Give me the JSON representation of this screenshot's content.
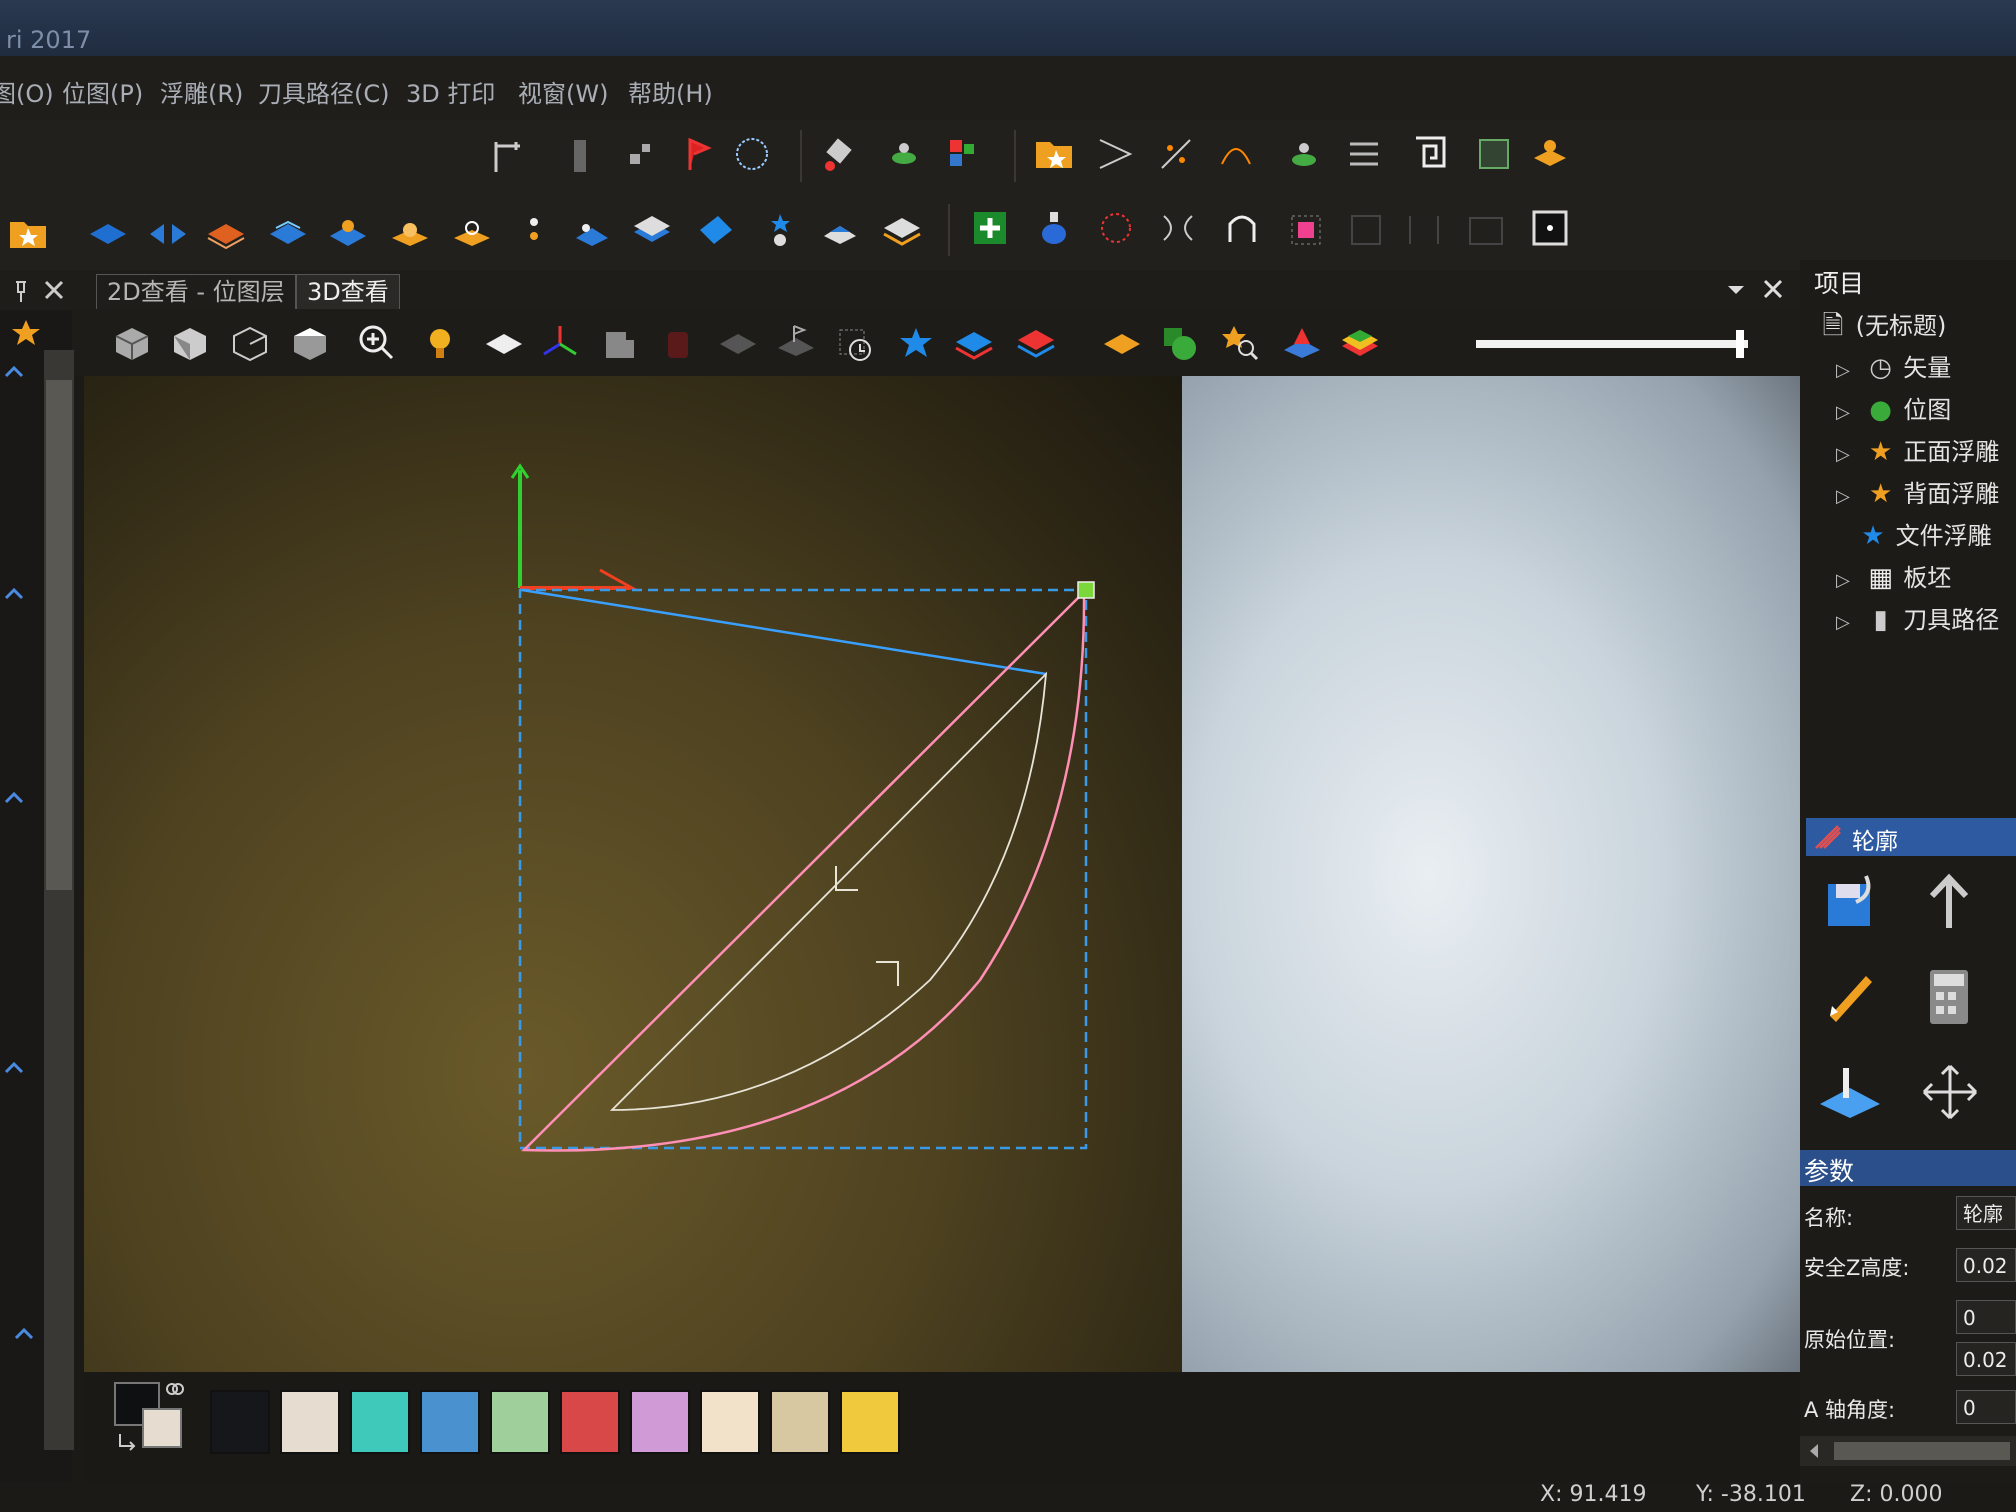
{
  "app": {
    "title_fragment": "ri 2017"
  },
  "menu": {
    "items": [
      "图(O)",
      "位图(P)",
      "浮雕(R)",
      "刀具路径(C)",
      "3D 打印",
      "视窗(W)",
      "帮助(H)"
    ]
  },
  "tabs": {
    "tab1": "2D查看 - 位图层",
    "tab2": "3D查看"
  },
  "project": {
    "title": "项目",
    "root": "(无标题)",
    "items": [
      {
        "label": "矢量",
        "icon": "vector-icon"
      },
      {
        "label": "位图",
        "icon": "bitmap-icon"
      },
      {
        "label": "正面浮雕",
        "icon": "star-icon"
      },
      {
        "label": "背面浮雕",
        "icon": "star-icon"
      },
      {
        "label": "文件浮雕",
        "icon": "blue-star-icon"
      },
      {
        "label": "板坯",
        "icon": "block-icon"
      },
      {
        "label": "刀具路径",
        "icon": "toolpath-icon"
      }
    ]
  },
  "profile": {
    "title": "轮廓",
    "params_title": "参数",
    "name_label": "名称:",
    "name_value": "轮廓",
    "safe_z_label": "安全Z高度:",
    "safe_z_value": "0.02",
    "home_label": "原始位置:",
    "home_x": "0",
    "home_z": "0.02",
    "a_axis_label": "A 轴角度:",
    "a_axis_value": "0"
  },
  "status": {
    "x": "X: 91.419",
    "y": "Y: -38.101",
    "z": "Z: 0.000"
  },
  "colors": {
    "swatches": [
      "#15171a",
      "#e6ddd0",
      "#3fc9bb",
      "#4a92cf",
      "#9fcf9a",
      "#d94848",
      "#cf9ad6",
      "#f1e2c9",
      "#d8c8a2",
      "#f0c93c"
    ],
    "accent": "#2d5aa0",
    "toolpath_pink": "#ff8aa8",
    "toolpath_white": "#e8e8e8",
    "bbox_blue": "#3a9ae8"
  },
  "tree_icons": [
    "vector-icon",
    "bitmap-icon",
    "star-icon",
    "block-icon",
    "toolpath-icon"
  ]
}
